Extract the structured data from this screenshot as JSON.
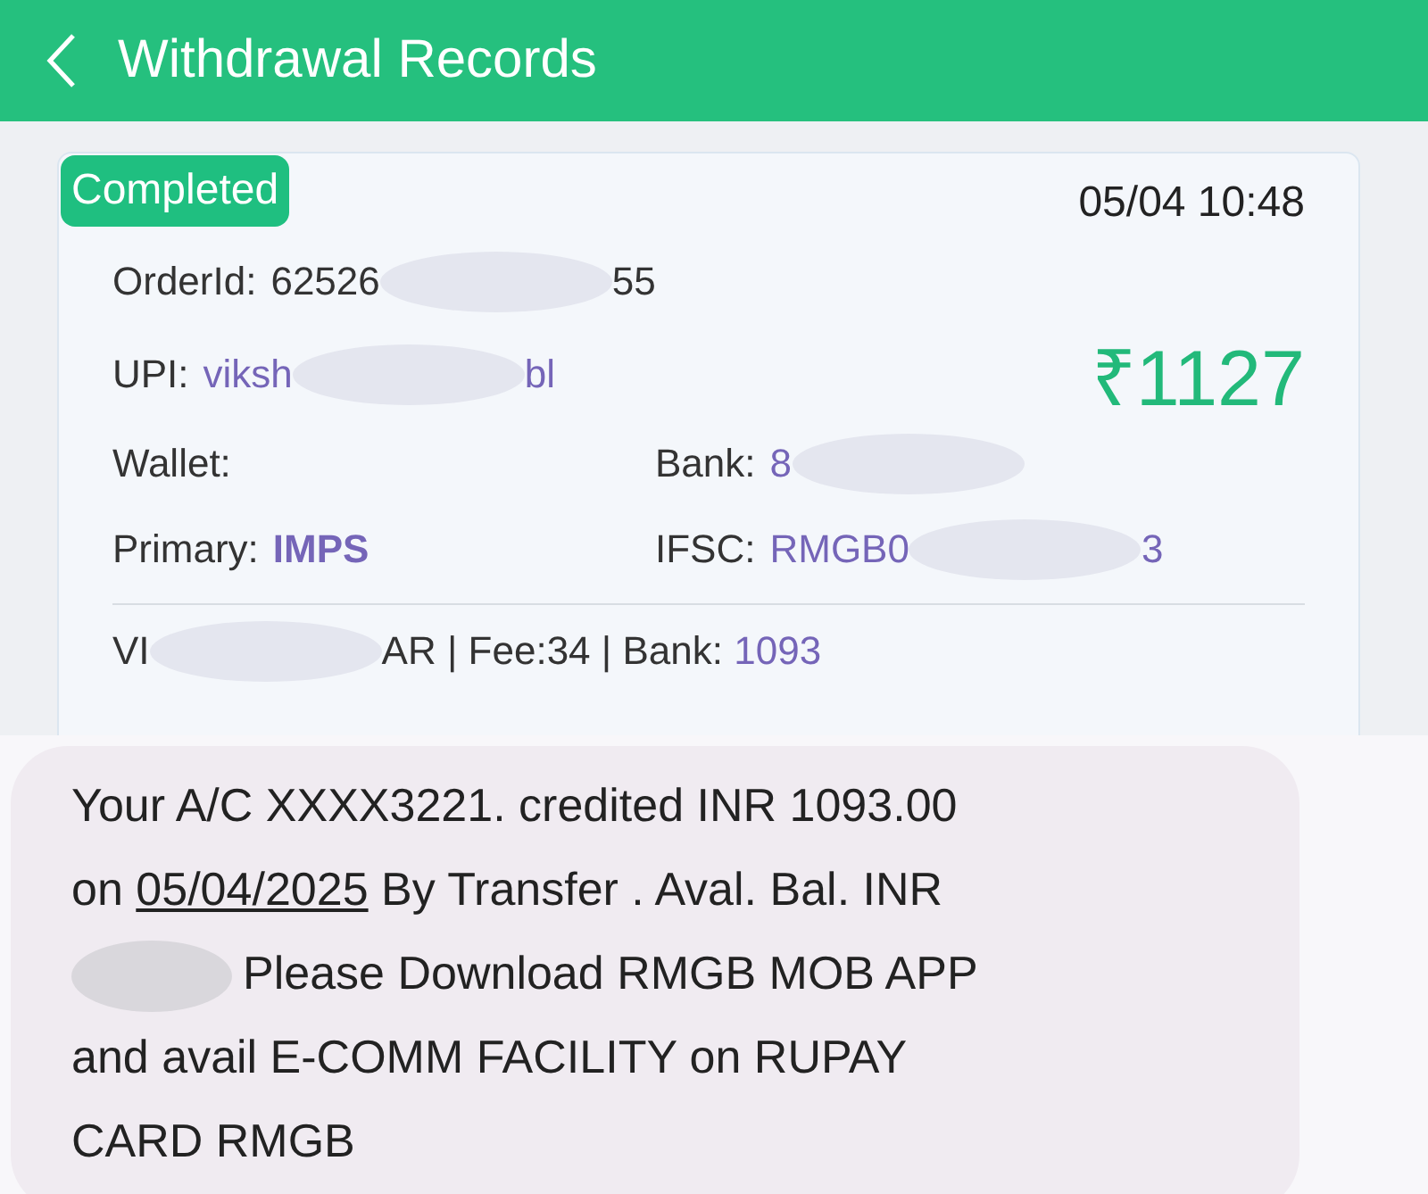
{
  "header": {
    "title": "Withdrawal Records"
  },
  "record": {
    "status": "Completed",
    "time": "05/04 10:48",
    "amount": "₹1127",
    "fields": [
      {
        "label": "OrderId:",
        "segments": [
          {
            "kind": "plain",
            "text": "62526"
          },
          {
            "kind": "redaction"
          },
          {
            "kind": "plain",
            "text": "55"
          }
        ]
      },
      {
        "label": "UPI:",
        "segments": [
          {
            "kind": "accent",
            "text": "viksh"
          },
          {
            "kind": "redaction"
          },
          {
            "kind": "accent",
            "text": "bl"
          }
        ]
      }
    ],
    "pairs": [
      [
        {
          "label": "Wallet:"
        },
        {
          "label": "Bank:",
          "segments": [
            {
              "kind": "accent",
              "text": "8"
            },
            {
              "kind": "redaction"
            }
          ]
        }
      ],
      [
        {
          "label": "Primary:",
          "segments": [
            {
              "kind": "accent_bold",
              "text": "IMPS"
            }
          ]
        },
        {
          "label": "IFSC:",
          "segments": [
            {
              "kind": "accent",
              "text": "RMGB0"
            },
            {
              "kind": "redaction"
            },
            {
              "kind": "accent",
              "text": "3"
            }
          ]
        }
      ]
    ],
    "footer": [
      {
        "kind": "plain",
        "text": "VI"
      },
      {
        "kind": "redaction"
      },
      {
        "kind": "plain",
        "text": "AR | Fee:34 | Bank: "
      },
      {
        "kind": "accent",
        "text": "1093"
      }
    ]
  },
  "sms": {
    "segments": [
      {
        "kind": "text",
        "text": "Your A/C XXXX3221. credited INR 1093.00 on "
      },
      {
        "kind": "link",
        "text": "05/04/2025"
      },
      {
        "kind": "text",
        "text": " By Transfer . Aval. Bal. INR "
      },
      {
        "kind": "redaction"
      },
      {
        "kind": "text",
        "text": "Please Download RMGB MOB APP and avail E-COMM FACILITY on RUPAY CARD RMGB"
      }
    ]
  }
}
